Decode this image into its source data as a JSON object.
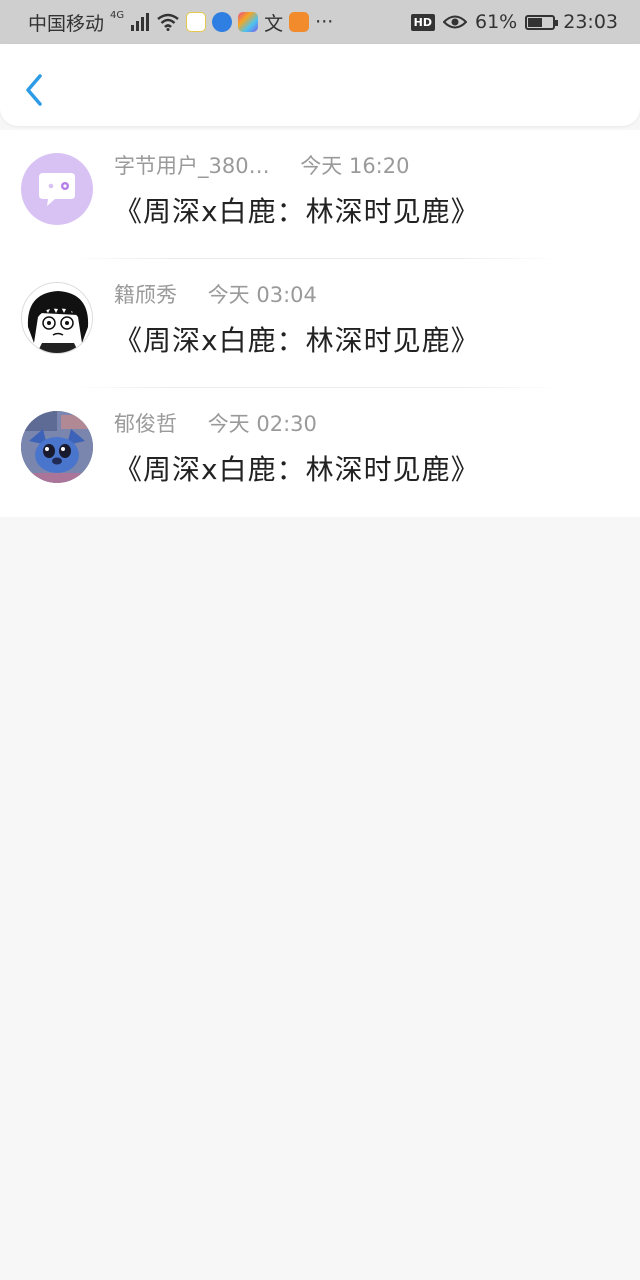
{
  "status_bar": {
    "carrier": "中国移动",
    "network": "4G",
    "hd": "HD",
    "battery_percent_text": "61%",
    "battery_level": 0.61,
    "time": "23:03",
    "more": "···"
  },
  "comments": [
    {
      "name": "字节用户_380…",
      "time": "今天 16:20",
      "title": "《周深x白鹿：林深时见鹿》",
      "avatar": "chat-bubble-avatar"
    },
    {
      "name": "籍颀秀",
      "time": "今天 03:04",
      "title": "《周深x白鹿：林深时见鹿》",
      "avatar": "anime-girl-avatar"
    },
    {
      "name": "郁俊哲",
      "time": "今天 02:30",
      "title": "《周深x白鹿：林深时见鹿》",
      "avatar": "stitch-avatar"
    }
  ],
  "colors": {
    "accent": "#2e9be6",
    "status_bar_bg": "#cfcfcf",
    "page_bg": "#f8f7f8",
    "meta_text": "#9a9a9a",
    "avatar_purple": "#d8c2f4"
  }
}
